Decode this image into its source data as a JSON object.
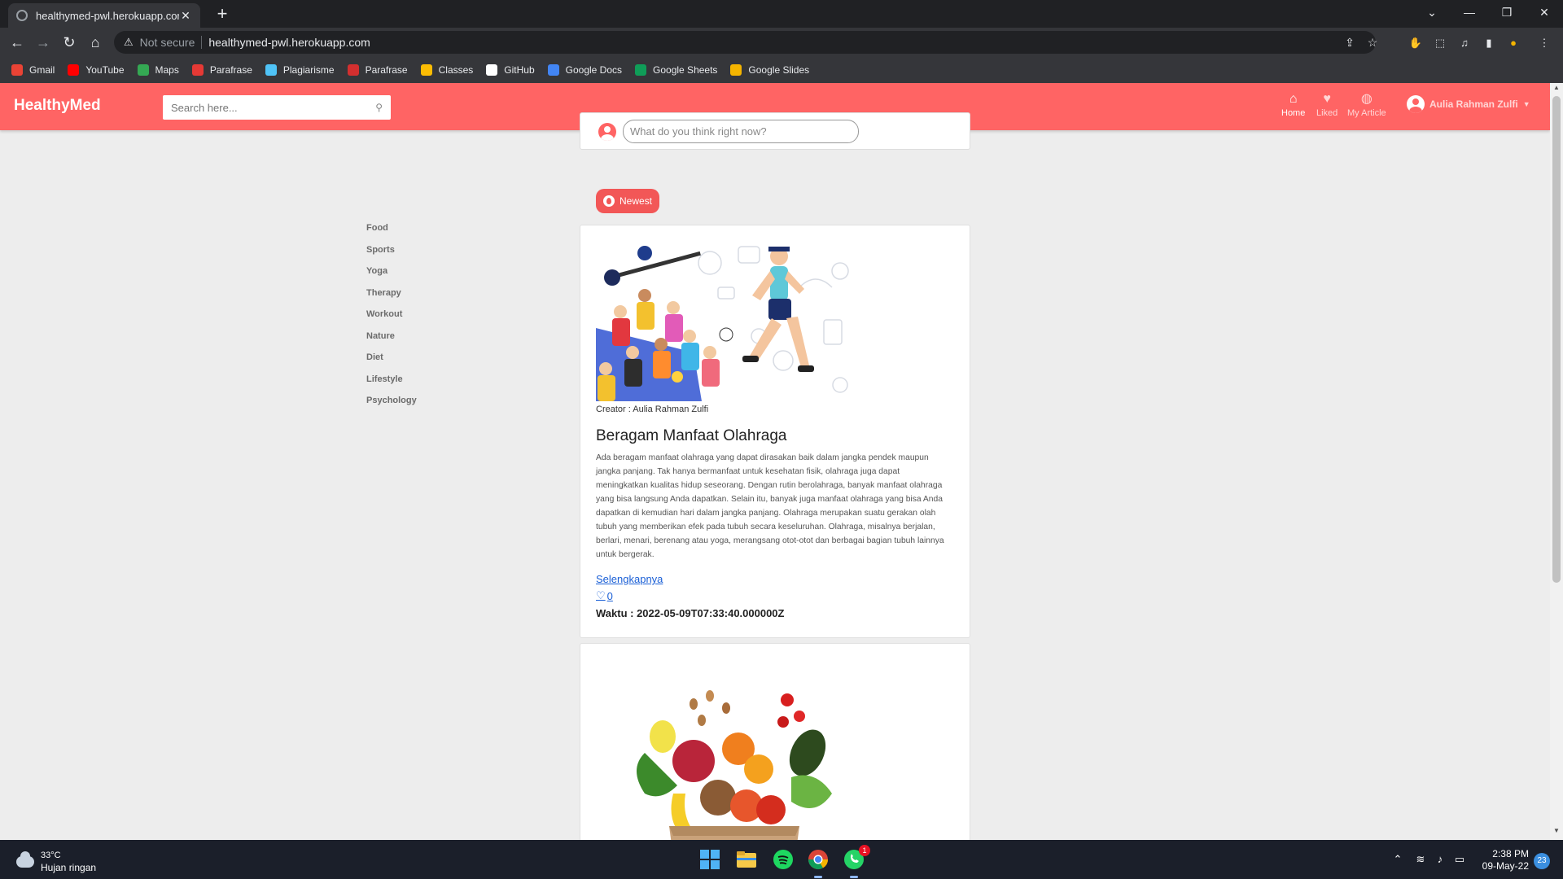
{
  "browser": {
    "tab_title": "healthymed-pwl.herokuapp.com",
    "new_tab_icon": "plus-icon",
    "not_secure": "Not secure",
    "url": "healthymed-pwl.herokuapp.com",
    "bookmarks": [
      {
        "label": "Gmail",
        "color": "#ea4335"
      },
      {
        "label": "YouTube",
        "color": "#ff0000"
      },
      {
        "label": "Maps",
        "color": "#34a853"
      },
      {
        "label": "Parafrase",
        "color": "#e53935"
      },
      {
        "label": "Plagiarisme",
        "color": "#4fc3f7"
      },
      {
        "label": "Parafrase",
        "color": "#d32f2f"
      },
      {
        "label": "Classes",
        "color": "#fbbc04"
      },
      {
        "label": "GitHub",
        "color": "#ffffff"
      },
      {
        "label": "Google Docs",
        "color": "#4285f4"
      },
      {
        "label": "Google Sheets",
        "color": "#0f9d58"
      },
      {
        "label": "Google Slides",
        "color": "#f4b400"
      }
    ]
  },
  "site": {
    "brand": "HealthyMed",
    "accent_color": "#ff6464",
    "search_placeholder": "Search here...",
    "nav": {
      "home": "Home",
      "liked": "Liked",
      "my_article": "My Article"
    },
    "user_name": "Aulia Rahman Zulfi",
    "categories": [
      "Food",
      "Sports",
      "Yoga",
      "Therapy",
      "Workout",
      "Nature",
      "Diet",
      "Lifestyle",
      "Psychology"
    ],
    "composer_placeholder": "What do you think right now?",
    "sort_button": "Newest",
    "articles": [
      {
        "creator": "Creator : Aulia Rahman Zulfi",
        "title": "Beragam Manfaat Olahraga",
        "body": "Ada beragam manfaat olahraga yang dapat dirasakan baik dalam jangka pendek maupun jangka panjang. Tak hanya bermanfaat untuk kesehatan fisik, olahraga juga dapat meningkatkan kualitas hidup seseorang. Dengan rutin berolahraga, banyak manfaat olahraga yang bisa langsung Anda dapatkan. Selain itu, banyak juga manfaat olahraga yang bisa Anda dapatkan di kemudian hari dalam jangka panjang. Olahraga merupakan suatu gerakan olah tubuh yang memberikan efek pada tubuh secara keseluruhan. Olahraga, misalnya berjalan, berlari, menari, berenang atau yoga, merangsang otot-otot dan berbagai bagian tubuh lainnya untuk bergerak.",
        "more": "Selengkapnya",
        "likes": "0",
        "time": "Waktu : 2022-05-09T07:33:40.000000Z"
      }
    ]
  },
  "taskbar": {
    "temperature": "33°C",
    "weather": "Hujan ringan",
    "time": "2:38 PM",
    "date": "09-May-22",
    "notifications": "23",
    "whatsapp_badge": "1"
  }
}
